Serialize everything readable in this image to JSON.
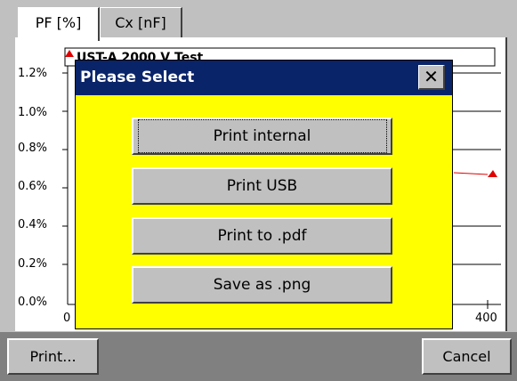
{
  "tabs": [
    {
      "label": "PF [%]",
      "active": true
    },
    {
      "label": "Cx [nF]",
      "active": false
    }
  ],
  "plot": {
    "legend_text": "UST-A   2000 V Test",
    "y_ticks": [
      "1.2%",
      "1.0%",
      "0.8%",
      "0.6%",
      "0.4%",
      "0.2%",
      "0.0%"
    ],
    "x_ticks": [
      "0",
      "400"
    ],
    "series_color": "#e00000"
  },
  "dialog": {
    "title": "Please Select",
    "close_symbol": "✕",
    "buttons": [
      "Print internal",
      "Print USB",
      "Print to .pdf",
      "Save as .png"
    ],
    "background": "#ffff00",
    "title_background": "#0a246a"
  },
  "bottom_bar": {
    "print_label": "Print...",
    "cancel_label": "Cancel"
  }
}
